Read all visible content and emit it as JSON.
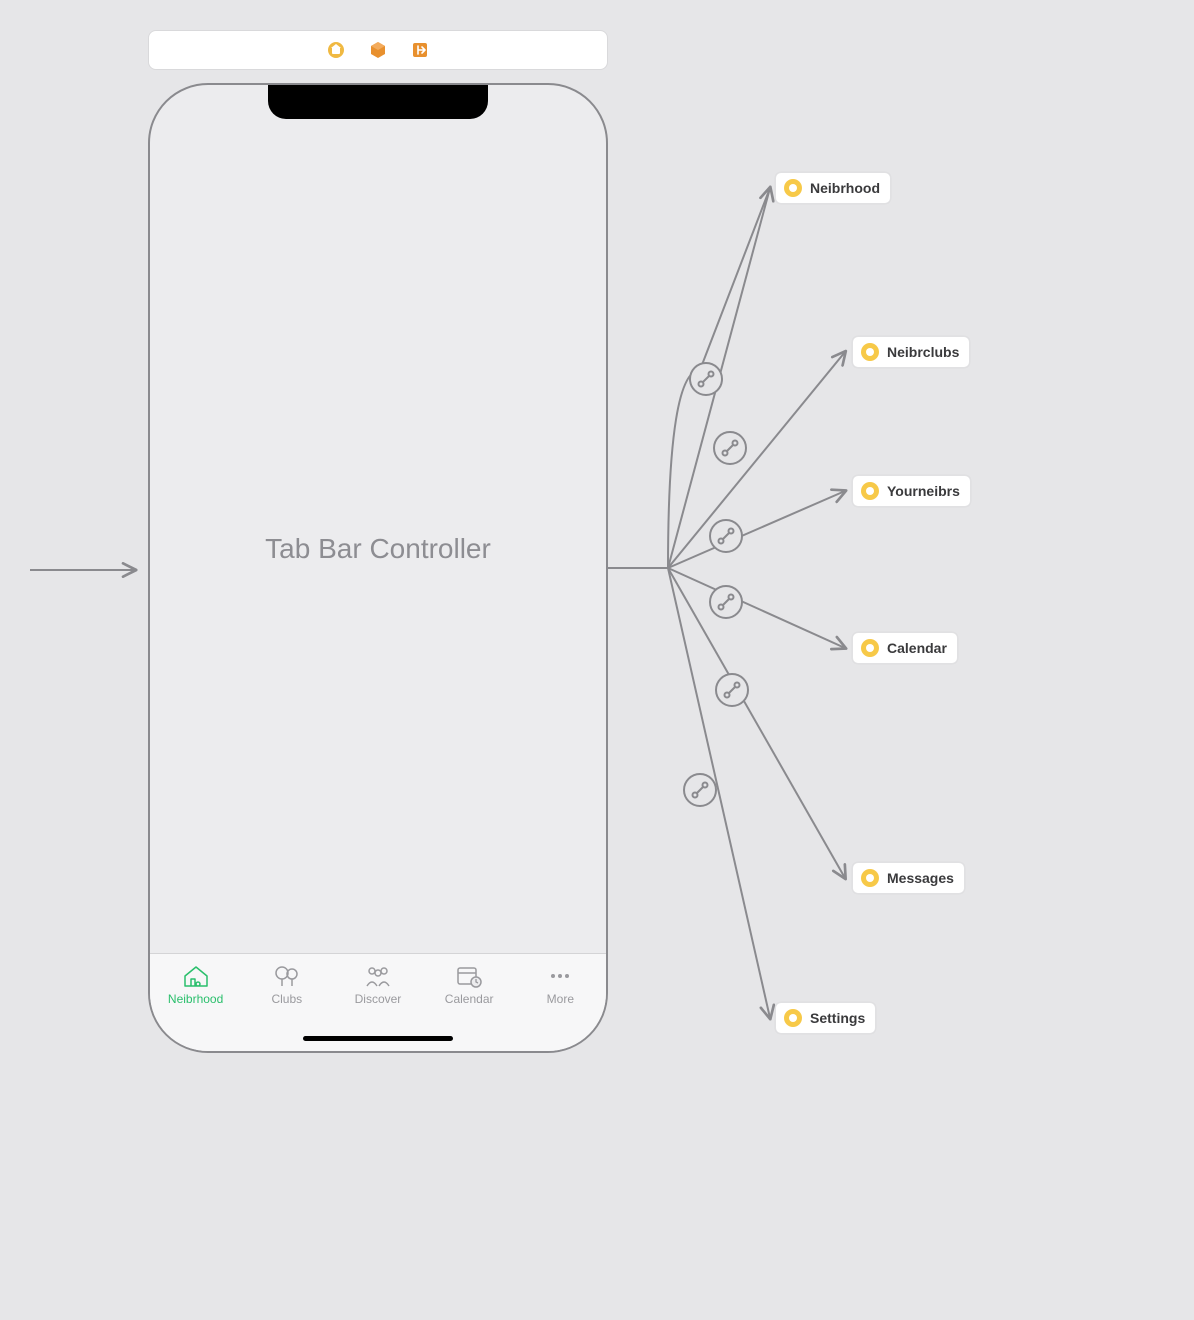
{
  "toolbar": {
    "items": [
      "scene-icon",
      "object-icon",
      "exit-icon"
    ]
  },
  "screen": {
    "title": "Tab Bar Controller",
    "tabs": [
      {
        "label": "Neibrhood",
        "icon": "house-icon",
        "active": true
      },
      {
        "label": "Clubs",
        "icon": "trees-icon",
        "active": false
      },
      {
        "label": "Discover",
        "icon": "people-icon",
        "active": false
      },
      {
        "label": "Calendar",
        "icon": "calendar-icon",
        "active": false
      },
      {
        "label": "More",
        "icon": "more-icon",
        "active": false
      }
    ]
  },
  "destinations": [
    {
      "label": "Neibrhood"
    },
    {
      "label": "Neibrclubs"
    },
    {
      "label": "Yourneibrs"
    },
    {
      "label": "Calendar"
    },
    {
      "label": "Messages"
    },
    {
      "label": "Settings"
    }
  ],
  "colors": {
    "active_tint": "#2abf6c",
    "chip_dot": "#f7c948",
    "toolbar_orange": "#e8902e",
    "toolbar_yellow": "#f0b942"
  }
}
